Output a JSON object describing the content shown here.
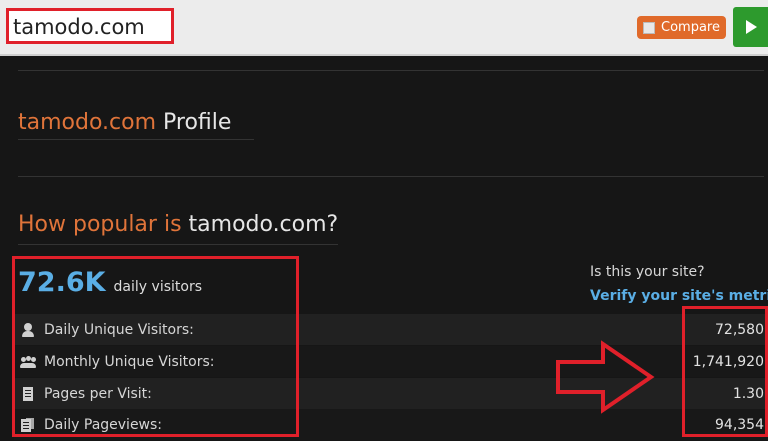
{
  "search": {
    "value": "tamodo.com",
    "compare_label": "Compare"
  },
  "profile": {
    "domain": "tamodo.com",
    "suffix": "Profile"
  },
  "popular": {
    "prefix": "How popular is",
    "domain": "tamodo.com?"
  },
  "daily": {
    "value": "72.6K",
    "unit": "daily visitors"
  },
  "claim": {
    "question": "Is this your site?",
    "verify_link": "Verify your site's metrics"
  },
  "metrics": [
    {
      "icon": "user-icon",
      "label": "Daily Unique Visitors:",
      "value": "72,580"
    },
    {
      "icon": "users-icon",
      "label": "Monthly Unique Visitors:",
      "value": "1,741,920"
    },
    {
      "icon": "page-icon",
      "label": "Pages per Visit:",
      "value": "1.30"
    },
    {
      "icon": "pages-icon",
      "label": "Daily Pageviews:",
      "value": "94,354"
    }
  ],
  "colors": {
    "accent_orange": "#e0743a",
    "accent_blue": "#5aaee5",
    "annotation_red": "#e0202a",
    "go_green": "#2d9a2d"
  }
}
